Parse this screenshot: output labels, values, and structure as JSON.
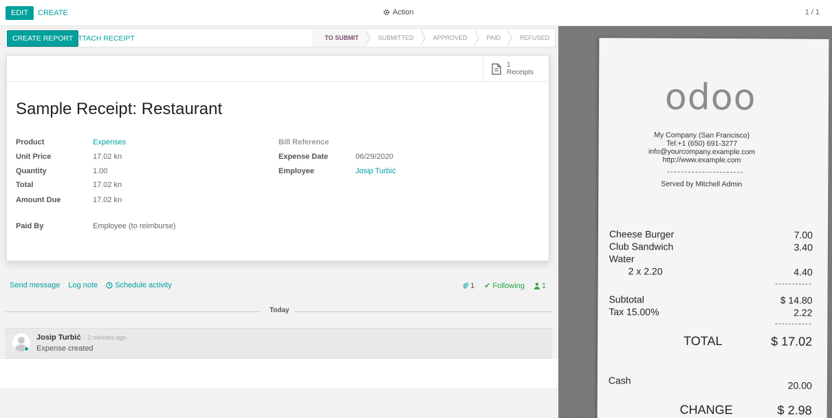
{
  "toolbar": {
    "edit_label": "EDIT",
    "create_label": "CREATE",
    "action_label": "Action",
    "pager": "1 / 1"
  },
  "statusbar": {
    "create_report_label": "CREATE REPORT",
    "attach_receipt_label": "ATTACH RECEIPT",
    "stages": [
      "TO SUBMIT",
      "SUBMITTED",
      "APPROVED",
      "PAID",
      "REFUSED"
    ],
    "active_stage": "TO SUBMIT"
  },
  "smart_button": {
    "count": "1",
    "label": "Receipts"
  },
  "form": {
    "title": "Sample Receipt: Restaurant",
    "product_label": "Product",
    "product_value": "Expenses",
    "unit_price_label": "Unit Price",
    "unit_price_value": "17.02 kn",
    "quantity_label": "Quantity",
    "quantity_value": "1.00",
    "total_label": "Total",
    "total_value": "17.02 kn",
    "amount_due_label": "Amount Due",
    "amount_due_value": "17.02 kn",
    "paid_by_label": "Paid By",
    "paid_by_value": "Employee (to reimburse)",
    "bill_reference_label": "Bill Reference",
    "expense_date_label": "Expense Date",
    "expense_date_value": "06/29/2020",
    "employee_label": "Employee",
    "employee_value": "Josip Turbić"
  },
  "chatter": {
    "send_message": "Send message",
    "log_note": "Log note",
    "schedule_activity": "Schedule activity",
    "attachments_count": "1",
    "following": "Following",
    "followers_count": "1",
    "today": "Today",
    "message": {
      "author": "Josip Turbić",
      "time": "- 2 minutes ago",
      "body": "Expense created"
    }
  },
  "receipt": {
    "logo": "odoo",
    "company": "My Company (San Francisco)",
    "tel": "Tel:+1 (650) 691-3277",
    "email": "info@yourcompany.example.com",
    "website": "http://www.example.com",
    "served_by": "Served by Mitchell Admin",
    "items": [
      {
        "name": "Cheese Burger",
        "amount": "7.00"
      },
      {
        "name": "Club Sandwich",
        "amount": "3.40"
      },
      {
        "name": "Water",
        "amount": ""
      },
      {
        "name": "2 x 2.20",
        "amount": "4.40"
      }
    ],
    "subtotal_label": "Subtotal",
    "subtotal": "$ 14.80",
    "tax_label": "Tax 15.00%",
    "tax": "2.22",
    "total_label": "TOTAL",
    "total": "$ 17.02",
    "cash_label": "Cash",
    "cash": "20.00",
    "change_label": "CHANGE",
    "change": "$ 2.98"
  },
  "colors": {
    "primary": "#00a09d",
    "active_stage": "#7c4b6e",
    "following": "#28a745"
  }
}
